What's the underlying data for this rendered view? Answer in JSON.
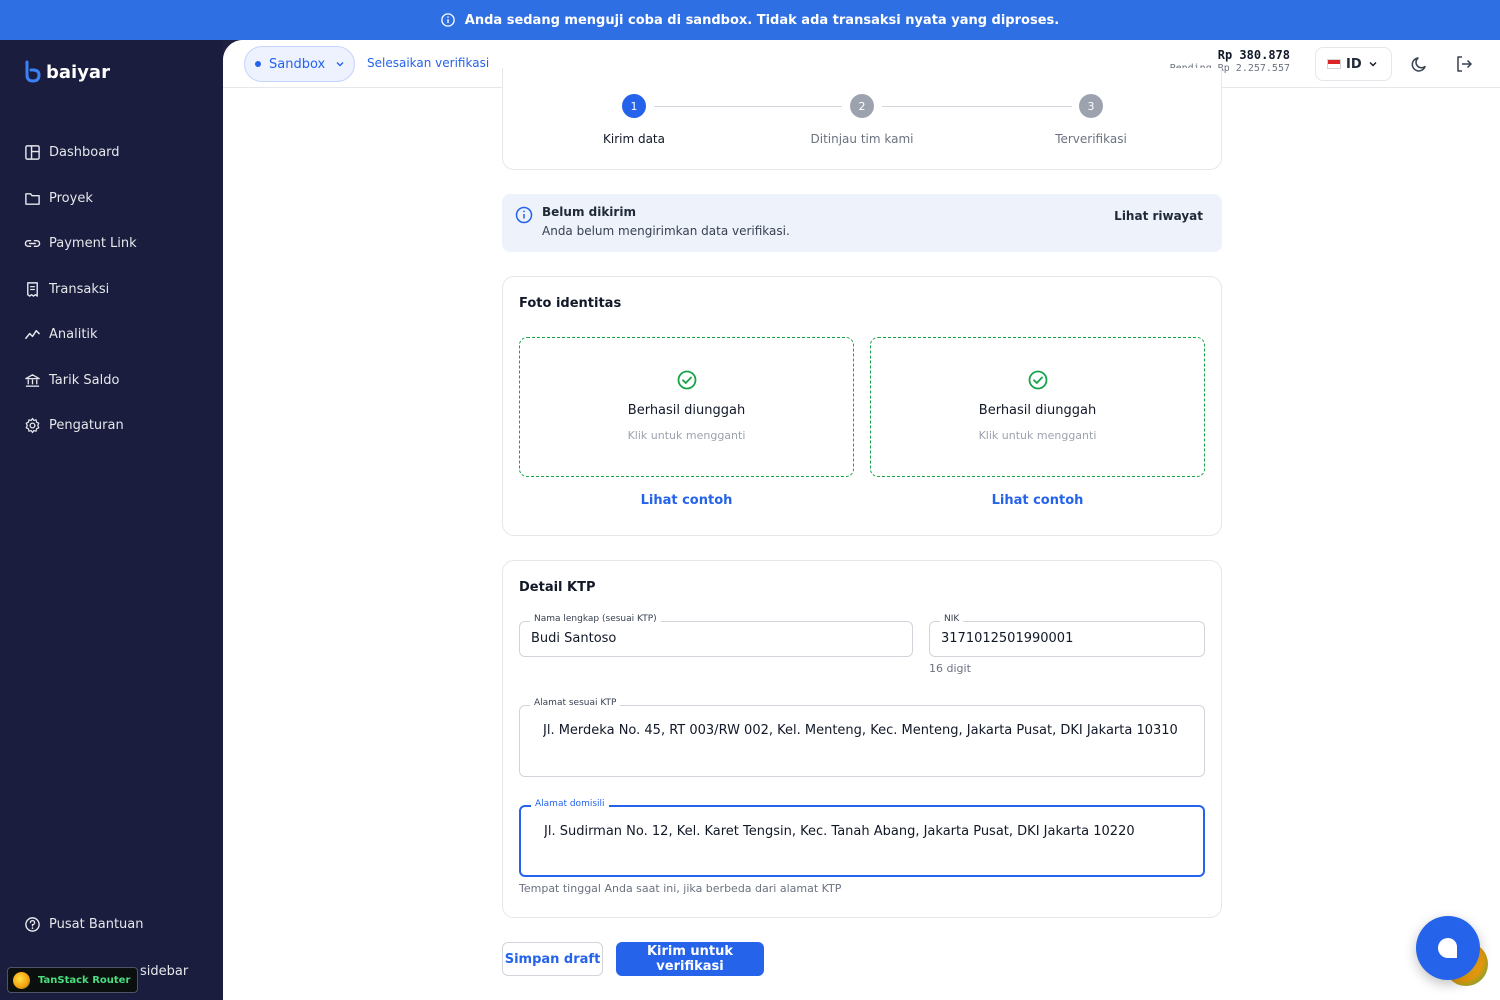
{
  "banner": {
    "text": "Anda sedang menguji coba di sandbox. Tidak ada transaksi nyata yang diproses."
  },
  "sidebar": {
    "logo": "baiyar",
    "items": [
      {
        "label": "Dashboard",
        "icon": "dashboard-icon"
      },
      {
        "label": "Proyek",
        "icon": "folder-icon"
      },
      {
        "label": "Payment Link",
        "icon": "link-icon"
      },
      {
        "label": "Transaksi",
        "icon": "receipt-icon"
      },
      {
        "label": "Analitik",
        "icon": "analytics-icon"
      },
      {
        "label": "Tarik Saldo",
        "icon": "bank-icon"
      },
      {
        "label": "Pengaturan",
        "icon": "gear-icon"
      }
    ],
    "help": "Pusat Bantuan",
    "collapse": "sidebar",
    "devtools_badge": "TanStack Router"
  },
  "topbar": {
    "env": "Sandbox",
    "verify_link": "Selesaikan verifikasi",
    "balance": "Rp 380.878",
    "pending": "Pending Rp 2.257.557",
    "lang": "ID"
  },
  "stepper": {
    "steps": [
      {
        "num": "1",
        "label": "Kirim data"
      },
      {
        "num": "2",
        "label": "Ditinjau tim kami"
      },
      {
        "num": "3",
        "label": "Terverifikasi"
      }
    ]
  },
  "alert": {
    "title": "Belum dikirim",
    "subtitle": "Anda belum mengirimkan data verifikasi.",
    "link": "Lihat riwayat"
  },
  "photo": {
    "title": "Foto identitas",
    "uploads": [
      {
        "status": "Berhasil diunggah",
        "hint": "Klik untuk mengganti",
        "example": "Lihat contoh"
      },
      {
        "status": "Berhasil diunggah",
        "hint": "Klik untuk mengganti",
        "example": "Lihat contoh"
      }
    ]
  },
  "ktp": {
    "title": "Detail KTP",
    "name_label": "Nama lengkap (sesuai KTP)",
    "name_value": "Budi Santoso",
    "nik_label": "NIK",
    "nik_value": "3171012501990001",
    "nik_hint": "16 digit",
    "address_label": "Alamat sesuai KTP",
    "address_value": "Jl. Merdeka No. 45, RT 003/RW 002, Kel. Menteng, Kec. Menteng, Jakarta Pusat, DKI Jakarta 10310",
    "domicile_label": "Alamat domisili",
    "domicile_value": "Jl. Sudirman No. 12, Kel. Karet Tengsin, Kec. Tanah Abang, Jakarta Pusat, DKI Jakarta 10220",
    "domicile_hint": "Tempat tinggal Anda saat ini, jika berbeda dari alamat KTP"
  },
  "actions": {
    "save_draft": "Simpan draft",
    "submit": "Kirim untuk verifikasi"
  },
  "colors": {
    "accent": "#2563eb",
    "sidebar": "#1a1d3d",
    "success": "#16a34a",
    "banner": "#2f6fe4"
  }
}
